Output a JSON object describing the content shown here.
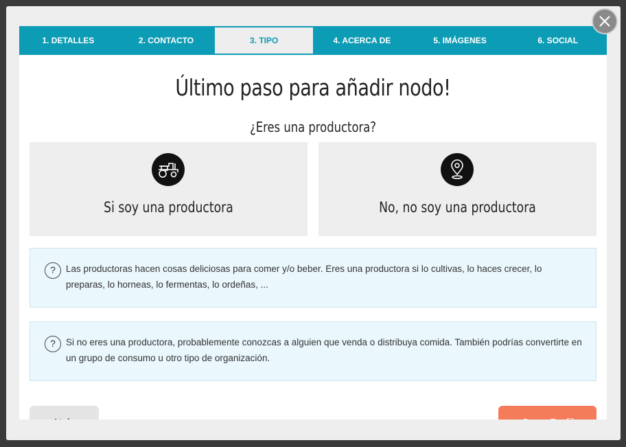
{
  "tabs": [
    {
      "label": "1. DETALLES"
    },
    {
      "label": "2. CONTACTO"
    },
    {
      "label": "3. TIPO"
    },
    {
      "label": "4. ACERCA DE"
    },
    {
      "label": "5. IMÁGENES"
    },
    {
      "label": "6. SOCIAL"
    }
  ],
  "active_tab": "3. TIPO",
  "title": "Último paso para añadir nodo!",
  "question": "¿Eres una productora?",
  "choices": [
    {
      "label": "Si soy una productora",
      "icon": "tractor-icon"
    },
    {
      "label": "No, no soy una productora",
      "icon": "map-pin-icon"
    }
  ],
  "info": [
    {
      "icon": "question-icon",
      "text": "Las productoras hacen cosas deliciosas para comer y/o beber. Eres una productora si lo cultivas, lo haces crecer, lo preparas, lo horneas, lo fermentas, lo ordeñas, ..."
    },
    {
      "icon": "question-icon",
      "text": "Si no eres una productora, probablemente conozcas a alguien que venda o distribuya comida. También podrías convertirte en un grupo de consumo u otro tipo de organización."
    }
  ],
  "buttons": {
    "back": "Atrás",
    "create": "Crear Perfil"
  },
  "colors": {
    "accent": "#0d9cb5",
    "create_button": "#f47c5a",
    "info_background": "#eaf7fd"
  }
}
